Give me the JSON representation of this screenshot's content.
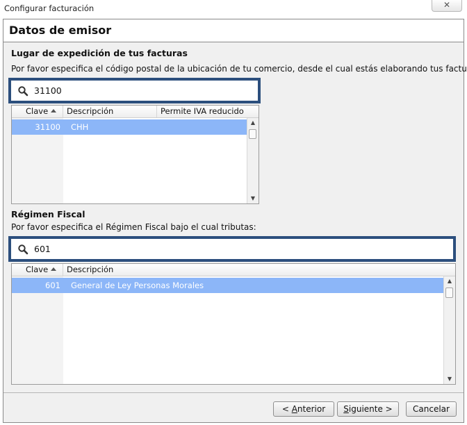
{
  "window": {
    "title": "Configurar facturación",
    "close_glyph": "✕"
  },
  "header": {
    "title": "Datos de emisor"
  },
  "expedicion": {
    "section_title": "Lugar de expedición de tus facturas",
    "instruction": "Por favor especifica el código postal de la ubicación de tu comercio, desde el cual estás elaborando tus facturas:",
    "search_value": "31100",
    "columns": [
      "Clave",
      "Descripción",
      "Permite IVA reducido"
    ],
    "rows": [
      {
        "clave": "31100",
        "descripcion": "CHH",
        "iva": ""
      }
    ]
  },
  "regimen": {
    "section_title": "Régimen Fiscal",
    "instruction": "Por favor especifica el Régimen Fiscal bajo el cual tributas:",
    "search_value": "601",
    "columns": [
      "Clave",
      "Descripción"
    ],
    "rows": [
      {
        "clave": "601",
        "descripcion": "General de Ley Personas Morales"
      }
    ]
  },
  "buttons": {
    "back_prefix": "< ",
    "back_mnemonic": "A",
    "back_rest": "nterior",
    "next_mnemonic": "S",
    "next_rest": "iguiente >",
    "cancel_label": "Cancelar"
  },
  "icons": {
    "search": "search-icon",
    "sort": "sort-ascending-icon",
    "close": "close-icon"
  },
  "colors": {
    "selection": "#8cb6f8",
    "search_border": "#2c4f7d"
  }
}
